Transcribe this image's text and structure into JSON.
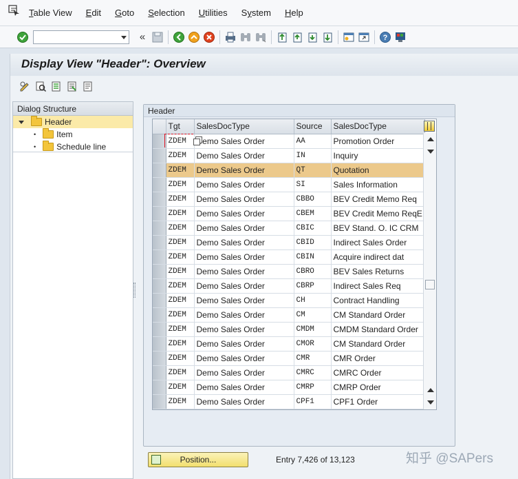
{
  "menu": {
    "items": [
      {
        "label": "Table View",
        "key": "T"
      },
      {
        "label": "Edit",
        "key": "E"
      },
      {
        "label": "Goto",
        "key": "G"
      },
      {
        "label": "Selection",
        "key": "S"
      },
      {
        "label": "Utilities",
        "key": "U"
      },
      {
        "label": "System",
        "key": "y"
      },
      {
        "label": "Help",
        "key": "H"
      }
    ]
  },
  "toolbar": {
    "command_field_value": ""
  },
  "title": "Display View \"Header\": Overview",
  "dialog_structure": {
    "header": "Dialog Structure",
    "nodes": [
      {
        "label": "Header",
        "selected": true
      },
      {
        "label": "Item",
        "selected": false
      },
      {
        "label": "Schedule line",
        "selected": false
      }
    ]
  },
  "table": {
    "group_title": "Header",
    "columns": [
      "Tgt",
      "SalesDocType",
      "Source",
      "SalesDocType"
    ],
    "rows": [
      [
        "ZDEM",
        "Demo Sales Order",
        "AA",
        "Promotion Order"
      ],
      [
        "ZDEM",
        "Demo Sales Order",
        "IN",
        "Inquiry"
      ],
      [
        "ZDEM",
        "Demo Sales Order",
        "QT",
        "Quotation"
      ],
      [
        "ZDEM",
        "Demo Sales Order",
        "SI",
        "Sales Information"
      ],
      [
        "ZDEM",
        "Demo Sales Order",
        "CBBO",
        "BEV Credit Memo Req"
      ],
      [
        "ZDEM",
        "Demo Sales Order",
        "CBEM",
        "BEV Credit Memo ReqE"
      ],
      [
        "ZDEM",
        "Demo Sales Order",
        "CBIC",
        "BEV Stand. O. IC CRM"
      ],
      [
        "ZDEM",
        "Demo Sales Order",
        "CBID",
        "Indirect Sales Order"
      ],
      [
        "ZDEM",
        "Demo Sales Order",
        "CBIN",
        "Acquire indirect dat"
      ],
      [
        "ZDEM",
        "Demo Sales Order",
        "CBRO",
        "BEV Sales Returns"
      ],
      [
        "ZDEM",
        "Demo Sales Order",
        "CBRP",
        "Indirect Sales Req"
      ],
      [
        "ZDEM",
        "Demo Sales Order",
        "CH",
        "Contract Handling"
      ],
      [
        "ZDEM",
        "Demo Sales Order",
        "CM",
        "CM Standard Order"
      ],
      [
        "ZDEM",
        "Demo Sales Order",
        "CMDM",
        "CMDM Standard Order"
      ],
      [
        "ZDEM",
        "Demo Sales Order",
        "CMOR",
        "CM Standard Order"
      ],
      [
        "ZDEM",
        "Demo Sales Order",
        "CMR",
        "CMR Order"
      ],
      [
        "ZDEM",
        "Demo Sales Order",
        "CMRC",
        "CMRC Order"
      ],
      [
        "ZDEM",
        "Demo Sales Order",
        "CMRP",
        "CMRP Order"
      ],
      [
        "ZDEM",
        "Demo Sales Order",
        "CPF1",
        "CPF1 Order"
      ]
    ],
    "highlighted_row": 2
  },
  "position_button": "Position...",
  "entry_text": "Entry 7,426 of 13,123",
  "watermark": "知乎 @SAPers",
  "colors": {
    "highlight": "#ecc98b",
    "selected_node": "#fbeaa8",
    "position_button": "#f2df6e"
  }
}
